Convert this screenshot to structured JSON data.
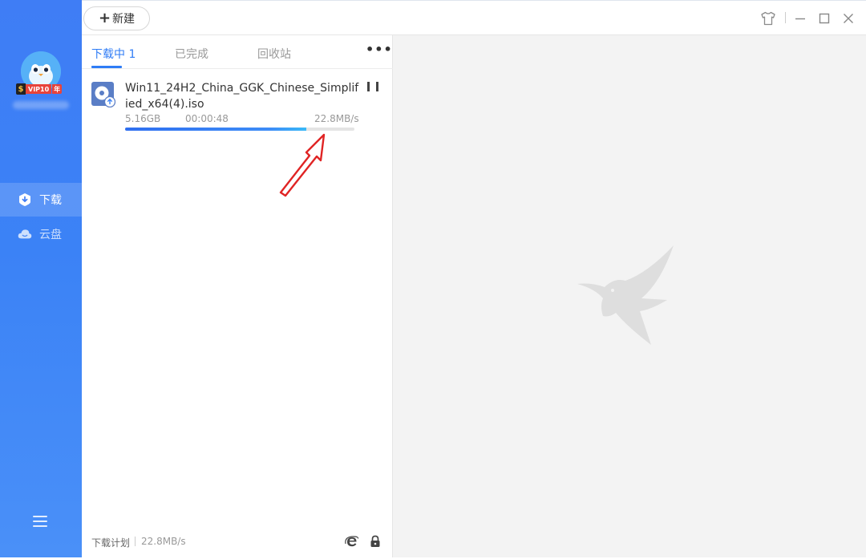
{
  "sidebar": {
    "vip_badge": {
      "symbol": "$",
      "level": "VIP10",
      "suffix": "年"
    },
    "nav": [
      {
        "label": "下载",
        "icon": "download-icon",
        "active": true
      },
      {
        "label": "云盘",
        "icon": "cloud-icon",
        "active": false
      }
    ],
    "menu_icon": "menu-icon"
  },
  "toolbar": {
    "new_label": "新建",
    "new_icon": "plus-icon",
    "window_controls": [
      "skin-icon",
      "minimize-icon",
      "maximize-icon",
      "close-icon"
    ]
  },
  "list": {
    "tabs": [
      {
        "label": "下载中 1",
        "active": true
      },
      {
        "label": "已完成",
        "active": false
      },
      {
        "label": "回收站",
        "active": false
      }
    ],
    "more_label": "•••",
    "task": {
      "file_name": "Win11_24H2_China_GGK_Chinese_Simplified_x64(4).iso",
      "size": "5.16GB",
      "remaining_time": "00:00:48",
      "speed": "22.8MB/s",
      "progress_percent": 79,
      "file_icon": "disc-image-icon",
      "action_icon": "pause-icon"
    },
    "footer": {
      "plan_label": "下载计划",
      "speed": "22.8MB/s",
      "icons": [
        "browser-icon",
        "lock-icon"
      ]
    }
  },
  "detail": {
    "watermark_icon": "hummingbird-logo-icon"
  },
  "colors": {
    "accent": "#2f7cf6",
    "sidebar": "#3b82f6",
    "annotation_arrow": "#e02424"
  }
}
